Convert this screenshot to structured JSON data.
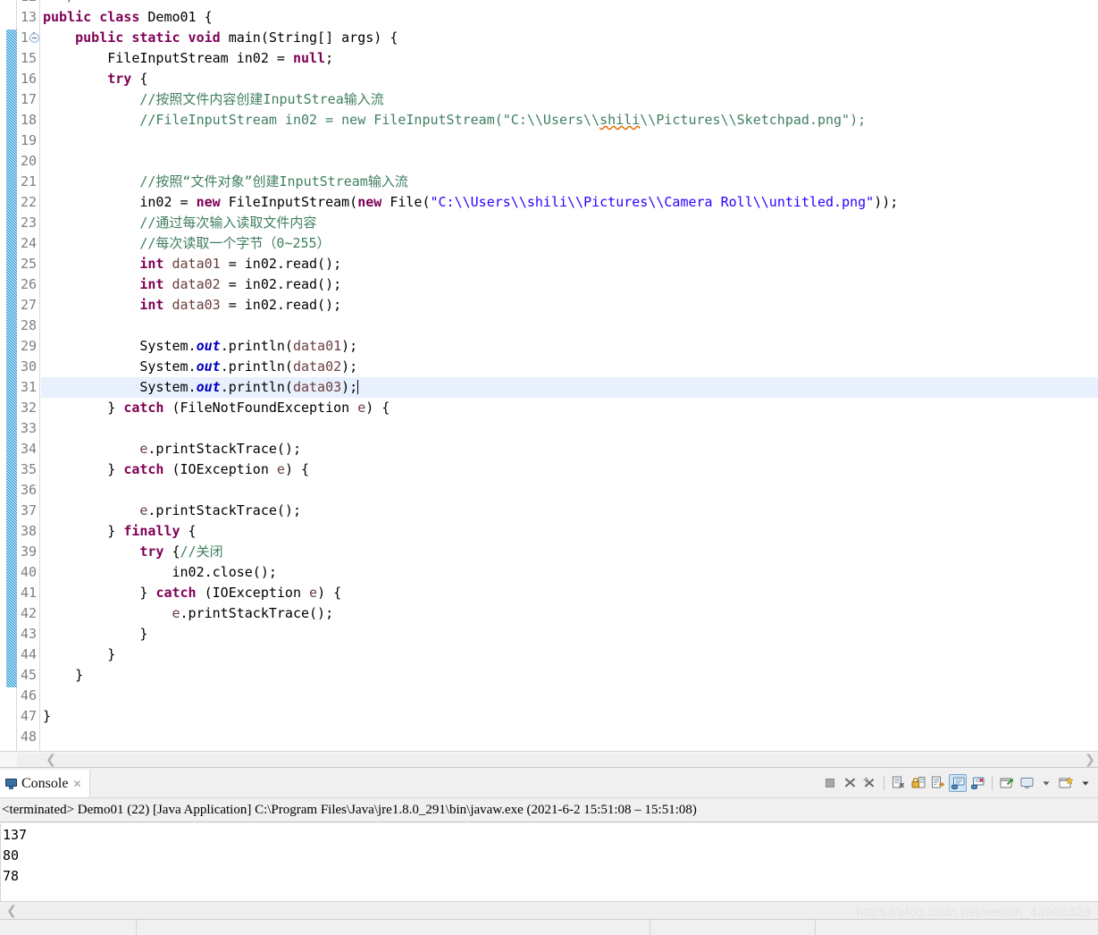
{
  "editor": {
    "first_visible_line": 12,
    "last_visible_line": 48,
    "highlighted_line": 31,
    "fold_marker_line": 14,
    "fold_range": [
      14,
      45
    ],
    "colors": {
      "keyword": "#7f0055",
      "comment": "#3f7f5f",
      "string": "#2a00ff",
      "field": "#0000c0",
      "local_var": "#6a3e3e",
      "line_highlight": "#e8f0fd",
      "gutter_text": "#808080",
      "fold_bar": "#2196d6",
      "spell_error": "#e06c00"
    },
    "lines": [
      {
        "n": 12,
        "segs": [
          {
            "t": "  ",
            "c": "plain"
          },
          {
            "t": "*/",
            "c": "cmt"
          }
        ]
      },
      {
        "n": 13,
        "segs": [
          {
            "t": "public class ",
            "c": "kw"
          },
          {
            "t": "Demo01 {",
            "c": "plain"
          }
        ]
      },
      {
        "n": 14,
        "segs": [
          {
            "t": "    ",
            "c": "plain"
          },
          {
            "t": "public static void ",
            "c": "kw"
          },
          {
            "t": "main(String[] args) {",
            "c": "plain"
          }
        ]
      },
      {
        "n": 15,
        "segs": [
          {
            "t": "        FileInputStream in02 = ",
            "c": "plain"
          },
          {
            "t": "null",
            "c": "kw"
          },
          {
            "t": ";",
            "c": "plain"
          }
        ]
      },
      {
        "n": 16,
        "segs": [
          {
            "t": "        ",
            "c": "plain"
          },
          {
            "t": "try",
            "c": "kw"
          },
          {
            "t": " {",
            "c": "plain"
          }
        ]
      },
      {
        "n": 17,
        "segs": [
          {
            "t": "            //按照文件内容创建InputStrea输入流",
            "c": "cmt"
          }
        ]
      },
      {
        "n": 18,
        "segs": [
          {
            "t": "            //FileInputStream in02 = new FileInputStream(\"C:\\\\Users\\\\",
            "c": "cmt"
          },
          {
            "t": "shili",
            "c": "cmt-spell"
          },
          {
            "t": "\\\\Pictures\\\\Sketchpad.png\");",
            "c": "cmt"
          }
        ]
      },
      {
        "n": 19,
        "segs": []
      },
      {
        "n": 20,
        "segs": []
      },
      {
        "n": 21,
        "segs": [
          {
            "t": "            //按照“文件对象”创建InputStream输入流",
            "c": "cmt"
          }
        ]
      },
      {
        "n": 22,
        "segs": [
          {
            "t": "            in02 = ",
            "c": "plain"
          },
          {
            "t": "new",
            "c": "kw"
          },
          {
            "t": " FileInputStream(",
            "c": "plain"
          },
          {
            "t": "new",
            "c": "kw"
          },
          {
            "t": " File(",
            "c": "plain"
          },
          {
            "t": "\"C:\\\\Users\\\\shili\\\\Pictures\\\\Camera Roll\\\\untitled.png\"",
            "c": "str"
          },
          {
            "t": "));",
            "c": "plain"
          }
        ]
      },
      {
        "n": 23,
        "segs": [
          {
            "t": "            //通过每次输入读取文件内容",
            "c": "cmt"
          }
        ]
      },
      {
        "n": 24,
        "segs": [
          {
            "t": "            //每次读取一个字节（0~255）",
            "c": "cmt"
          }
        ]
      },
      {
        "n": 25,
        "segs": [
          {
            "t": "            ",
            "c": "plain"
          },
          {
            "t": "int",
            "c": "kw"
          },
          {
            "t": " ",
            "c": "plain"
          },
          {
            "t": "data01",
            "c": "loc"
          },
          {
            "t": " = in02.read();",
            "c": "plain"
          }
        ]
      },
      {
        "n": 26,
        "segs": [
          {
            "t": "            ",
            "c": "plain"
          },
          {
            "t": "int",
            "c": "kw"
          },
          {
            "t": " ",
            "c": "plain"
          },
          {
            "t": "data02",
            "c": "loc"
          },
          {
            "t": " = in02.read();",
            "c": "plain"
          }
        ]
      },
      {
        "n": 27,
        "segs": [
          {
            "t": "            ",
            "c": "plain"
          },
          {
            "t": "int",
            "c": "kw"
          },
          {
            "t": " ",
            "c": "plain"
          },
          {
            "t": "data03",
            "c": "loc"
          },
          {
            "t": " = in02.read();",
            "c": "plain"
          }
        ]
      },
      {
        "n": 28,
        "segs": []
      },
      {
        "n": 29,
        "segs": [
          {
            "t": "            System.",
            "c": "plain"
          },
          {
            "t": "out",
            "c": "fld"
          },
          {
            "t": ".println(",
            "c": "plain"
          },
          {
            "t": "data01",
            "c": "loc"
          },
          {
            "t": ");",
            "c": "plain"
          }
        ]
      },
      {
        "n": 30,
        "segs": [
          {
            "t": "            System.",
            "c": "plain"
          },
          {
            "t": "out",
            "c": "fld"
          },
          {
            "t": ".println(",
            "c": "plain"
          },
          {
            "t": "data02",
            "c": "loc"
          },
          {
            "t": ");",
            "c": "plain"
          }
        ]
      },
      {
        "n": 31,
        "segs": [
          {
            "t": "            System.",
            "c": "plain"
          },
          {
            "t": "out",
            "c": "fld"
          },
          {
            "t": ".println(",
            "c": "plain"
          },
          {
            "t": "data03",
            "c": "loc"
          },
          {
            "t": ");",
            "c": "plain"
          },
          {
            "t": "",
            "c": "caret"
          }
        ]
      },
      {
        "n": 32,
        "segs": [
          {
            "t": "        } ",
            "c": "plain"
          },
          {
            "t": "catch",
            "c": "kw"
          },
          {
            "t": " (FileNotFoundException ",
            "c": "plain"
          },
          {
            "t": "e",
            "c": "loc"
          },
          {
            "t": ") {",
            "c": "plain"
          }
        ]
      },
      {
        "n": 33,
        "segs": []
      },
      {
        "n": 34,
        "segs": [
          {
            "t": "            ",
            "c": "plain"
          },
          {
            "t": "e",
            "c": "loc"
          },
          {
            "t": ".printStackTrace();",
            "c": "plain"
          }
        ]
      },
      {
        "n": 35,
        "segs": [
          {
            "t": "        } ",
            "c": "plain"
          },
          {
            "t": "catch",
            "c": "kw"
          },
          {
            "t": " (IOException ",
            "c": "plain"
          },
          {
            "t": "e",
            "c": "loc"
          },
          {
            "t": ") {",
            "c": "plain"
          }
        ]
      },
      {
        "n": 36,
        "segs": []
      },
      {
        "n": 37,
        "segs": [
          {
            "t": "            ",
            "c": "plain"
          },
          {
            "t": "e",
            "c": "loc"
          },
          {
            "t": ".printStackTrace();",
            "c": "plain"
          }
        ]
      },
      {
        "n": 38,
        "segs": [
          {
            "t": "        } ",
            "c": "plain"
          },
          {
            "t": "finally",
            "c": "kw"
          },
          {
            "t": " {",
            "c": "plain"
          }
        ]
      },
      {
        "n": 39,
        "segs": [
          {
            "t": "            ",
            "c": "plain"
          },
          {
            "t": "try",
            "c": "kw"
          },
          {
            "t": " {",
            "c": "plain"
          },
          {
            "t": "//关闭",
            "c": "cmt"
          }
        ]
      },
      {
        "n": 40,
        "segs": [
          {
            "t": "                in02.close();",
            "c": "plain"
          }
        ]
      },
      {
        "n": 41,
        "segs": [
          {
            "t": "            } ",
            "c": "plain"
          },
          {
            "t": "catch",
            "c": "kw"
          },
          {
            "t": " (IOException ",
            "c": "plain"
          },
          {
            "t": "e",
            "c": "loc"
          },
          {
            "t": ") {",
            "c": "plain"
          }
        ]
      },
      {
        "n": 42,
        "segs": [
          {
            "t": "                ",
            "c": "plain"
          },
          {
            "t": "e",
            "c": "loc"
          },
          {
            "t": ".printStackTrace();",
            "c": "plain"
          }
        ]
      },
      {
        "n": 43,
        "segs": [
          {
            "t": "            }",
            "c": "plain"
          }
        ]
      },
      {
        "n": 44,
        "segs": [
          {
            "t": "        }",
            "c": "plain"
          }
        ]
      },
      {
        "n": 45,
        "segs": [
          {
            "t": "    }",
            "c": "plain"
          }
        ]
      },
      {
        "n": 46,
        "segs": []
      },
      {
        "n": 47,
        "segs": [
          {
            "t": "}",
            "c": "plain"
          }
        ]
      },
      {
        "n": 48,
        "segs": []
      }
    ]
  },
  "console": {
    "tab_label": "Console",
    "tab_close_glyph": "✕",
    "process_line": "<terminated> Demo01 (22) [Java Application] C:\\Program Files\\Java\\jre1.8.0_291\\bin\\javaw.exe  (2021-6-2 15:51:08 – 15:51:08)",
    "output_lines": [
      "137",
      "80",
      "78"
    ],
    "toolbar": [
      {
        "name": "terminate-button",
        "label": "Terminate",
        "enabled": false
      },
      {
        "name": "remove-launch-button",
        "label": "Remove Launch",
        "enabled": true
      },
      {
        "name": "remove-all-terminated-button",
        "label": "Remove All Terminated Launches",
        "enabled": true
      },
      {
        "name": "clear-console-button",
        "label": "Clear Console",
        "enabled": true
      },
      {
        "name": "scroll-lock-button",
        "label": "Scroll Lock",
        "enabled": true
      },
      {
        "name": "word-wrap-button",
        "label": "Word Wrap",
        "enabled": true
      },
      {
        "name": "pin-console-button",
        "label": "Pin Console",
        "enabled": true,
        "active": true
      },
      {
        "name": "display-selected-console-button",
        "label": "Display Selected Console",
        "enabled": true
      },
      {
        "name": "open-console-button",
        "label": "Open Console",
        "enabled": true
      },
      {
        "name": "show-console-view-button",
        "label": "Show Console View",
        "enabled": true
      },
      {
        "name": "show-console-dropdown",
        "label": "Show Console Menu",
        "enabled": true
      },
      {
        "name": "new-console-view-button",
        "label": "New Console View",
        "enabled": true
      },
      {
        "name": "view-menu-dropdown",
        "label": "View Menu",
        "enabled": true
      }
    ]
  },
  "watermark": {
    "text": "https://blog.csdn.net/weixin_43908328"
  },
  "scrollbars": {
    "left_arrow_glyph": "❮",
    "right_arrow_glyph": "❯"
  }
}
